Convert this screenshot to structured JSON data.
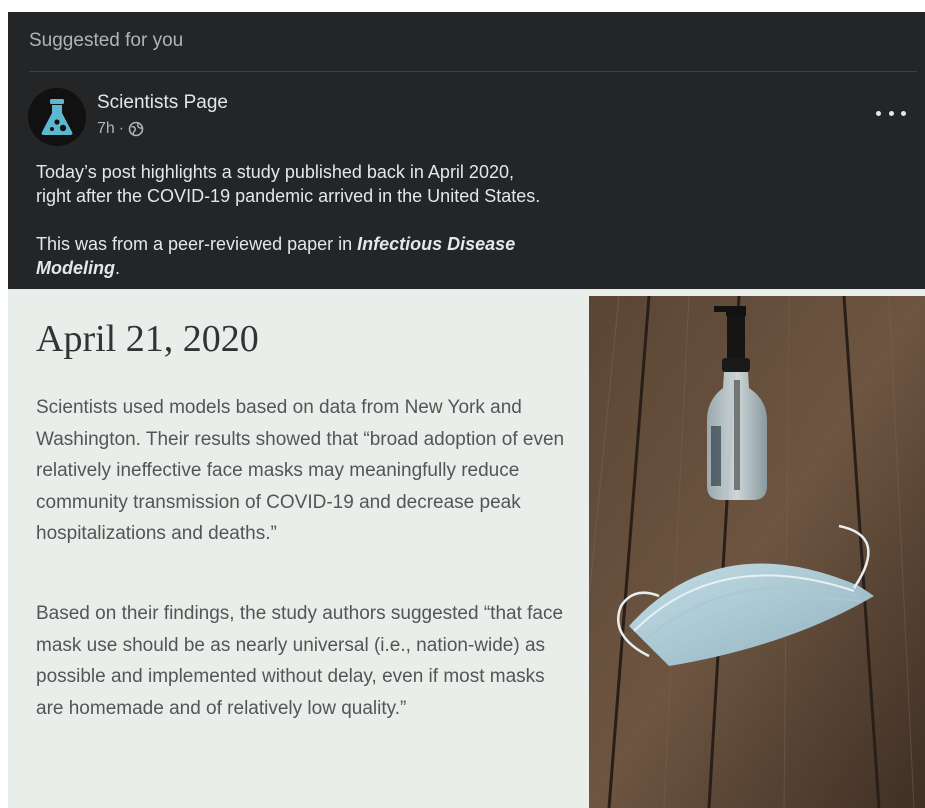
{
  "feed": {
    "header": "Suggested for you"
  },
  "post": {
    "page_name": "Scientists Page",
    "time": "7h",
    "separator": "·",
    "audience_icon": "globe-icon",
    "avatar_icon": "flask-icon",
    "more_icon": "more-options-icon",
    "text_line1": "Today’s post highlights a study published back in April 2020,",
    "text_line2": "right after the COVID-19 pandemic arrived in the United States.",
    "text2_prefix": "This was from a peer-reviewed paper in ",
    "text2_journal": "Infectious Disease Modeling",
    "text2_suffix": "."
  },
  "card": {
    "date": "April 21, 2020",
    "paragraph1": "Scientists used models based on data from New York and Washington. Their results showed that “broad adoption of even relatively ineffective face masks may meaningfully reduce community transmission of COVID-19 and decrease peak hospitalizations and deaths.”",
    "paragraph2": "Based on their findings, the study authors suggested “that face mask use should be as nearly universal (i.e., nation-wide) as possible and implemented without delay, even if most masks are homemade and of relatively low quality.”",
    "image_subject": "hand-sanitizer-and-face-mask-photo"
  },
  "colors": {
    "post_bg": "#242526",
    "post_text": "#e4e6eb",
    "secondary_text": "#b0b3b8",
    "card_bg": "#e9eeea",
    "flask_color": "#5bb8d0"
  }
}
